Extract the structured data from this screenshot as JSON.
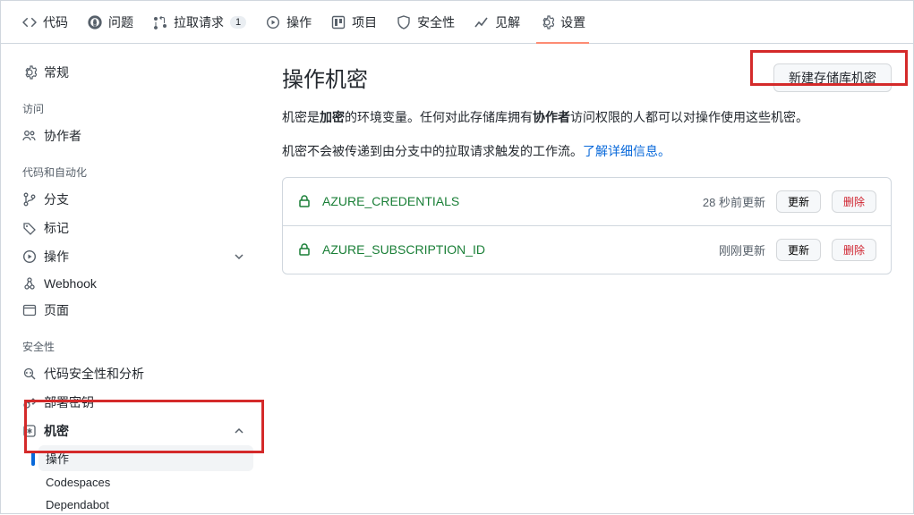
{
  "topnav": {
    "code": "代码",
    "issues": "问题",
    "pulls": "拉取请求",
    "pulls_count": "1",
    "actions": "操作",
    "projects": "项目",
    "security": "安全性",
    "insights": "见解",
    "settings": "设置"
  },
  "sidebar": {
    "general": "常规",
    "access_heading": "访问",
    "collaborators": "协作者",
    "code_heading": "代码和自动化",
    "branches": "分支",
    "tags": "标记",
    "actions": "操作",
    "webhook": "Webhook",
    "pages": "页面",
    "security_heading": "安全性",
    "code_security": "代码安全性和分析",
    "deploy_keys": "部署密钥",
    "secrets": "机密",
    "secrets_sub": {
      "actions": "操作",
      "codespaces": "Codespaces",
      "dependabot": "Dependabot"
    }
  },
  "main": {
    "title": "操作机密",
    "new_secret_btn": "新建存储库机密",
    "desc_p1_a": "机密是",
    "desc_p1_b": "加密",
    "desc_p1_c": "的环境变量。任何对此存储库拥有",
    "desc_p1_d": "协作者",
    "desc_p1_e": "访问权限的人都可以对操作使用这些机密。",
    "desc_p2_a": "机密不会被传递到由分支中的拉取请求触发的工作流。",
    "desc_p2_link": "了解详细信息。",
    "update_btn": "更新",
    "remove_btn": "删除",
    "secrets": [
      {
        "name": "AZURE_CREDENTIALS",
        "time": "28 秒前更新"
      },
      {
        "name": "AZURE_SUBSCRIPTION_ID",
        "time": "刚刚更新"
      }
    ]
  }
}
